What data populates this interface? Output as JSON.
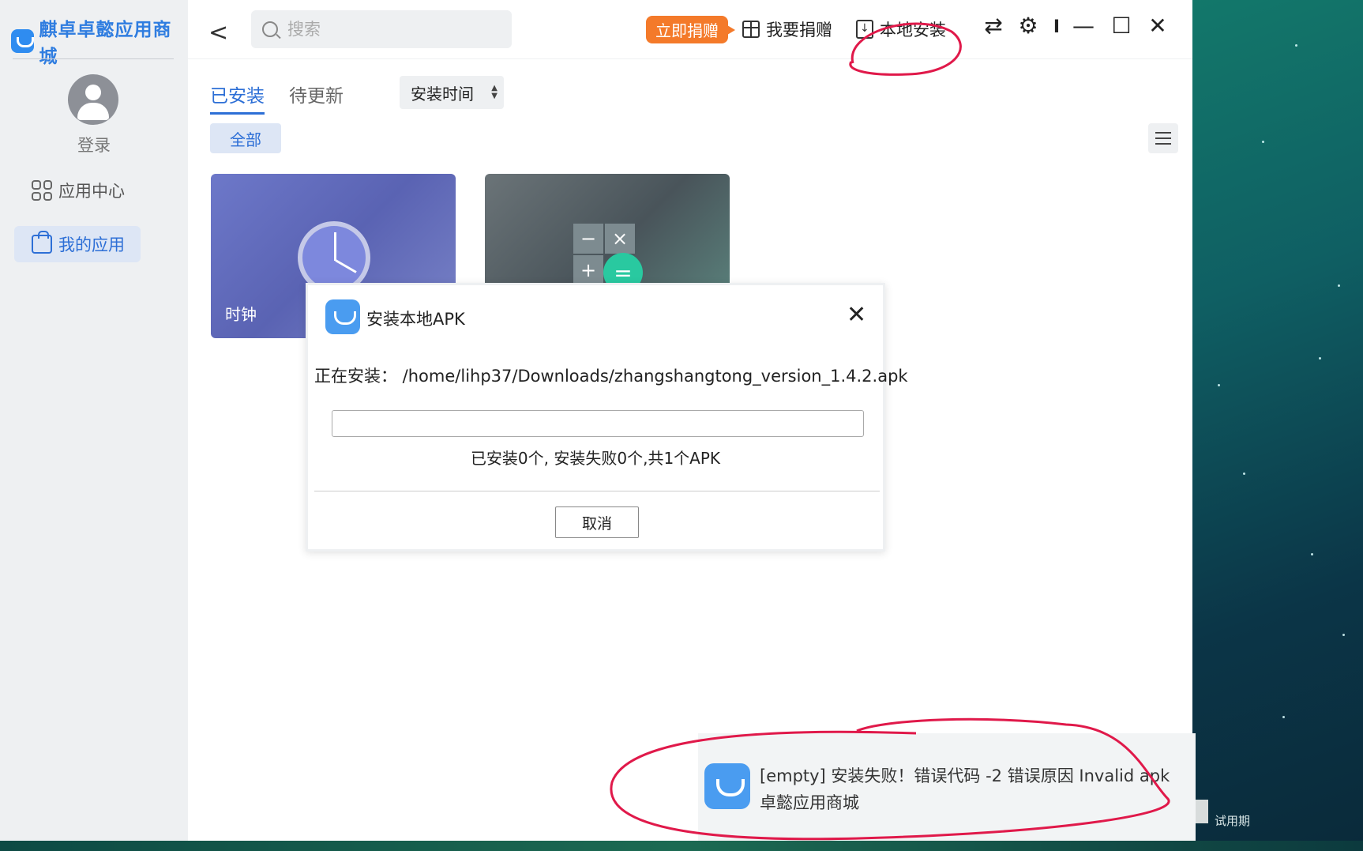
{
  "app": {
    "logo_text": "麒卓卓懿应用商城"
  },
  "sidebar": {
    "login_label": "登录",
    "items": [
      {
        "label": "应用中心"
      },
      {
        "label": "我的应用"
      }
    ]
  },
  "header": {
    "search_placeholder": "搜索",
    "donate_now": "立即捐赠",
    "donate": "我要捐赠",
    "local_install": "本地安装",
    "switch_icon": "⇄",
    "settings_icon": "⚙",
    "separator": "I",
    "minimize_icon": "—",
    "maximize_icon": "☐",
    "close_icon": "✕"
  },
  "tabs": [
    {
      "label": "已安装"
    },
    {
      "label": "待更新"
    }
  ],
  "sort": {
    "label": "安装时间"
  },
  "filter_chip": "全部",
  "apps": [
    {
      "name": "时钟"
    },
    {
      "name": ""
    }
  ],
  "calc_keys": {
    "minus": "−",
    "times": "×",
    "plus": "+",
    "equals": "="
  },
  "dialog": {
    "title": "安装本地APK",
    "close_icon": "✕",
    "path_line": "正在安装： /home/lihp37/Downloads/zhangshangtong_version_1.4.2.apk",
    "progress_percent": 0,
    "status": "已安装0个, 安装失败0个,共1个APK",
    "cancel": "取消"
  },
  "notification": {
    "message": "[empty] 安装失败！错误代码 -2 错误原因 Invalid apk",
    "app_name": "卓懿应用商城"
  },
  "desktop": {
    "trial_label": "试用期"
  },
  "colors": {
    "accent": "#2d6fd6",
    "donate": "#f47a2a",
    "annotation": "#e0194a"
  }
}
